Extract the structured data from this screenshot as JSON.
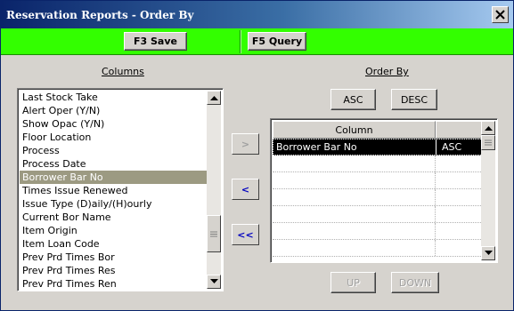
{
  "window": {
    "title": "Reservation Reports - Order By"
  },
  "toolbar": {
    "save_label": "F3 Save",
    "query_label": "F5 Query"
  },
  "columns": {
    "label": "Columns",
    "items": [
      "Last Stock Take",
      "Alert Oper (Y/N)",
      "Show Opac (Y/N)",
      "Floor Location",
      "Process",
      "Process Date",
      "Borrower Bar No",
      "Times Issue Renewed",
      "Issue Type (D)aily/(H)ourly",
      "Current Bor Name",
      "Item Origin",
      "Item Loan Code",
      "Prev Prd Times Bor",
      "Prev Prd Times Res",
      "Prev Prd Times Ren"
    ],
    "selected_item": "Borrower Bar No"
  },
  "transfer": {
    "add_label": ">",
    "remove_label": "<",
    "remove_all_label": "<<"
  },
  "order_by": {
    "label": "Order By",
    "asc_label": "ASC",
    "desc_label": "DESC",
    "column_header": "Column",
    "rows": [
      {
        "column": "Borrower Bar No",
        "direction": "ASC"
      },
      {
        "column": "",
        "direction": ""
      },
      {
        "column": "",
        "direction": ""
      },
      {
        "column": "",
        "direction": ""
      },
      {
        "column": "",
        "direction": ""
      },
      {
        "column": "",
        "direction": ""
      },
      {
        "column": "",
        "direction": ""
      }
    ],
    "up_label": "UP",
    "down_label": "DOWN"
  }
}
